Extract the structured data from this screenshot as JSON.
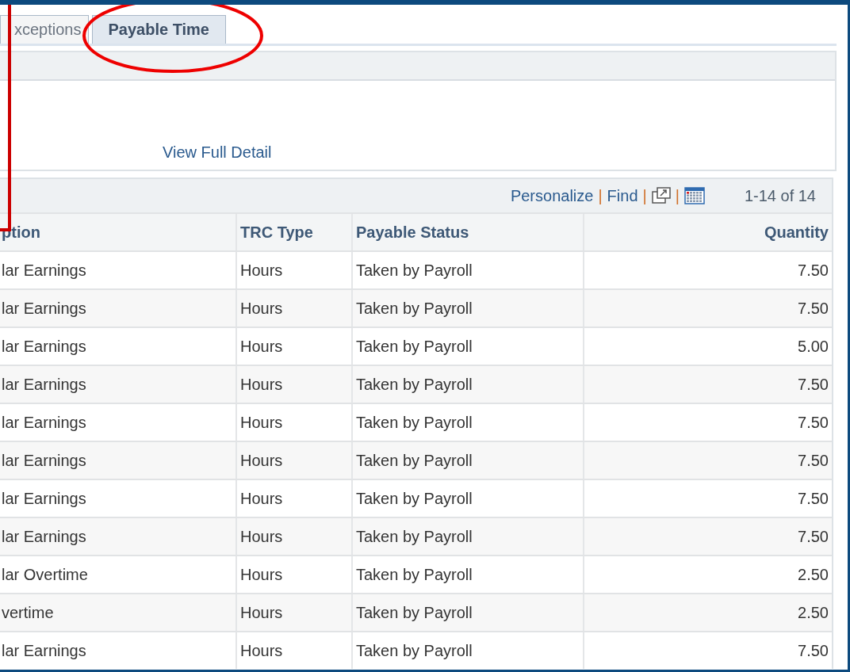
{
  "tabs": [
    {
      "label": "xceptions",
      "selected": false
    },
    {
      "label": "Payable Time",
      "selected": true
    }
  ],
  "detail_panel": {
    "link": "View Full Detail"
  },
  "grid": {
    "toolbar": {
      "personalize": "Personalize",
      "find": "Find",
      "separator": "|",
      "count": "1-14 of 14"
    },
    "columns": [
      "ption",
      "TRC Type",
      "Payable Status",
      "Quantity"
    ],
    "rows": [
      [
        "lar Earnings",
        "Hours",
        "Taken by Payroll",
        "7.50"
      ],
      [
        "lar Earnings",
        "Hours",
        "Taken by Payroll",
        "7.50"
      ],
      [
        "lar Earnings",
        "Hours",
        "Taken by Payroll",
        "5.00"
      ],
      [
        "lar Earnings",
        "Hours",
        "Taken by Payroll",
        "7.50"
      ],
      [
        "lar Earnings",
        "Hours",
        "Taken by Payroll",
        "7.50"
      ],
      [
        "lar Earnings",
        "Hours",
        "Taken by Payroll",
        "7.50"
      ],
      [
        "lar Earnings",
        "Hours",
        "Taken by Payroll",
        "7.50"
      ],
      [
        "lar Earnings",
        "Hours",
        "Taken by Payroll",
        "7.50"
      ],
      [
        "lar Overtime",
        "Hours",
        "Taken by Payroll",
        "2.50"
      ],
      [
        "vertime",
        "Hours",
        "Taken by Payroll",
        "2.50"
      ],
      [
        "lar Earnings",
        "Hours",
        "Taken by Payroll",
        "7.50"
      ]
    ]
  }
}
